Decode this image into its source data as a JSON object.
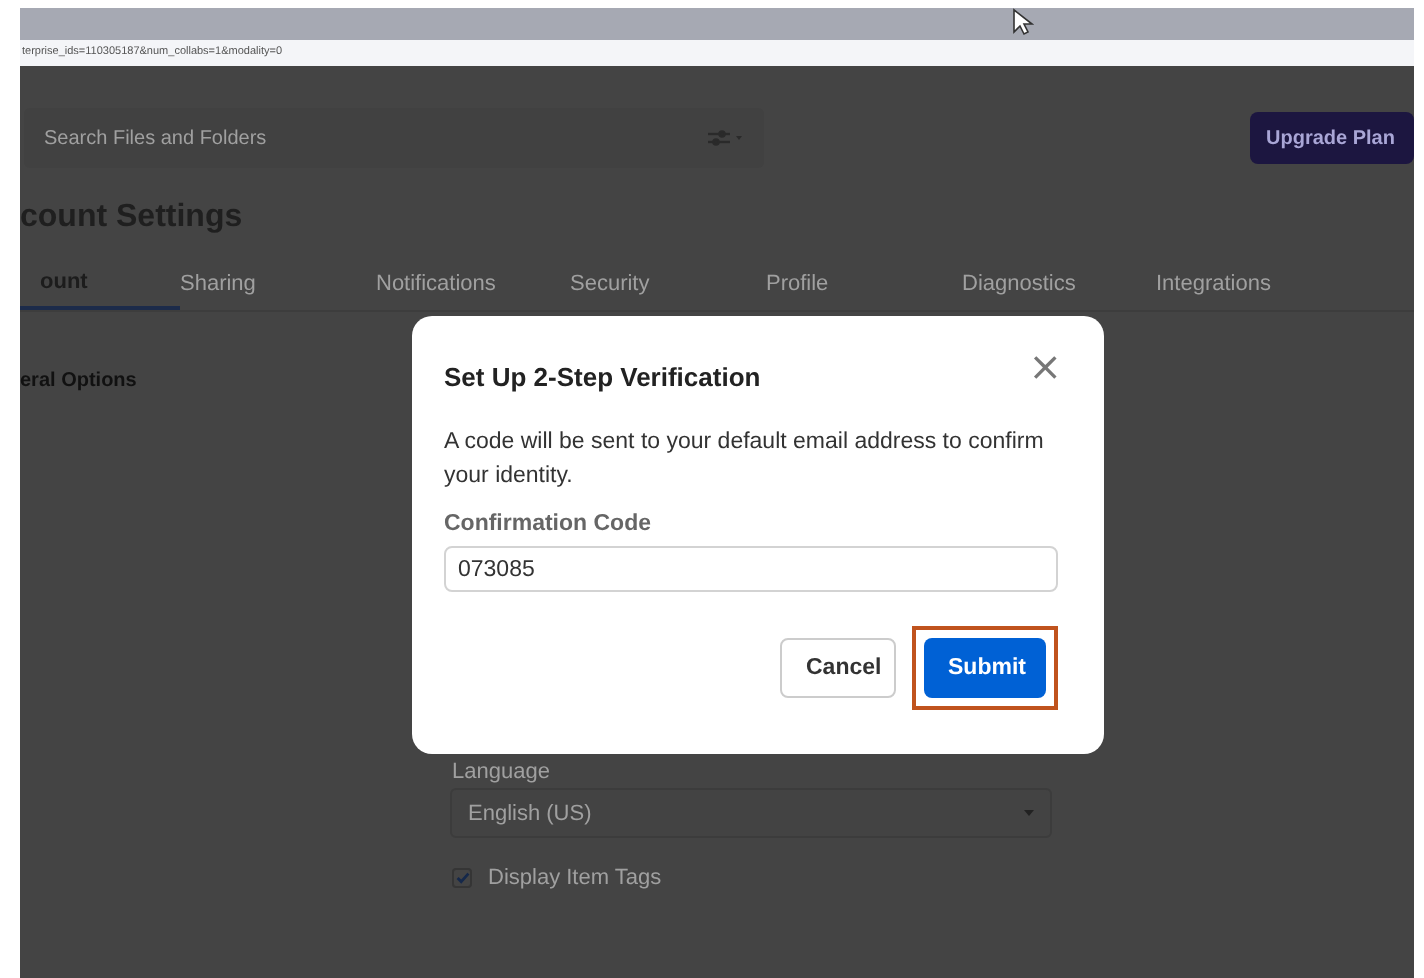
{
  "browser": {
    "url": "terprise_ids=110305187&num_collabs=1&modality=0"
  },
  "header": {
    "search": {
      "placeholder": "Search Files and Folders"
    },
    "upgrade_button": "Upgrade Plan"
  },
  "page_title": "count Settings",
  "tabs": [
    {
      "label": "ount",
      "selected": true
    },
    {
      "label": "Sharing",
      "selected": false
    },
    {
      "label": "Notifications",
      "selected": false
    },
    {
      "label": "Security",
      "selected": false
    },
    {
      "label": "Profile",
      "selected": false
    },
    {
      "label": "Diagnostics",
      "selected": false
    },
    {
      "label": "Integrations",
      "selected": false
    }
  ],
  "section_title": "eral Options",
  "language": {
    "label": "Language",
    "value": "English (US)"
  },
  "display_item_tags": {
    "label": "Display Item Tags",
    "checked": true
  },
  "dialog": {
    "title": "Set Up 2-Step Verification",
    "close": "×",
    "message": "A code will be sent to your default email address to confirm your identity.",
    "field_label": "Confirmation Code",
    "field_value": "073085",
    "buttons": [
      {
        "label": "Cancel",
        "kind": "secondary",
        "highlighted": false
      },
      {
        "label": "Submit",
        "kind": "primary",
        "highlighted": true
      }
    ]
  }
}
